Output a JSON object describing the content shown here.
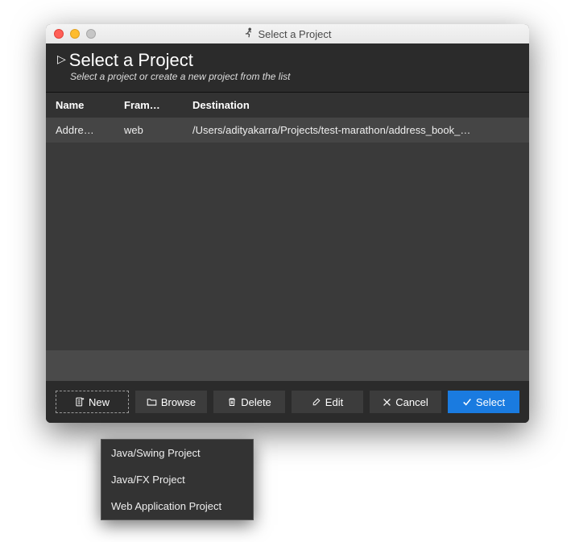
{
  "titlebar": {
    "title": "Select a Project"
  },
  "header": {
    "title": "Select a Project",
    "subtitle": "Select a project or create a new project from the list"
  },
  "table": {
    "columns": {
      "name": "Name",
      "fram": "Fram…",
      "dest": "Destination"
    },
    "rows": [
      {
        "name": "Addre…",
        "fram": "web",
        "dest": "/Users/adityakarra/Projects/test-marathon/address_book_…"
      }
    ]
  },
  "buttons": {
    "new": "New",
    "browse": "Browse",
    "delete": "Delete",
    "edit": "Edit",
    "cancel": "Cancel",
    "select": "Select"
  },
  "dropdown": {
    "items": [
      "Java/Swing Project",
      "Java/FX Project",
      "Web Application Project"
    ]
  }
}
